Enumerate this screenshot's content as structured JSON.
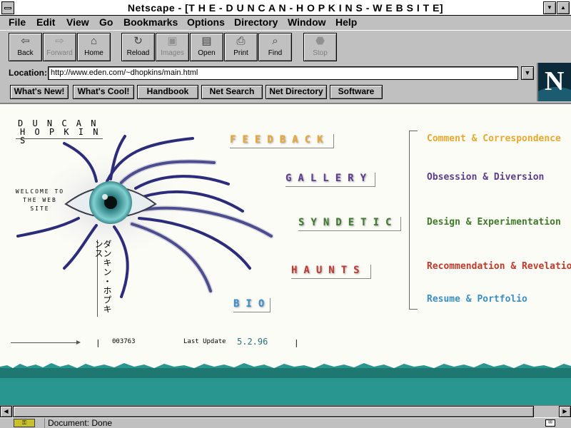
{
  "window": {
    "title": "Netscape - [T H E - D U N C A N - H O P K I N S - W E B S I T E]"
  },
  "menu": [
    "File",
    "Edit",
    "View",
    "Go",
    "Bookmarks",
    "Options",
    "Directory",
    "Window",
    "Help"
  ],
  "toolbar": [
    {
      "label": "Back",
      "icon": "back-arrow-icon",
      "glyph": "⇦",
      "enabled": true
    },
    {
      "label": "Forward",
      "icon": "forward-arrow-icon",
      "glyph": "⇨",
      "enabled": false
    },
    {
      "label": "Home",
      "icon": "home-icon",
      "glyph": "⌂",
      "enabled": true
    },
    {
      "label": "Reload",
      "icon": "reload-icon",
      "glyph": "↻",
      "enabled": true
    },
    {
      "label": "Images",
      "icon": "images-icon",
      "glyph": "▣",
      "enabled": false
    },
    {
      "label": "Open",
      "icon": "open-icon",
      "glyph": "▤",
      "enabled": true
    },
    {
      "label": "Print",
      "icon": "print-icon",
      "glyph": "⎙",
      "enabled": true
    },
    {
      "label": "Find",
      "icon": "find-binoculars-icon",
      "glyph": "⌕",
      "enabled": true
    },
    {
      "label": "Stop",
      "icon": "stop-icon",
      "glyph": "⬣",
      "enabled": false
    }
  ],
  "location": {
    "label": "Location:",
    "url": "http://www.eden.com/~dhopkins/main.html"
  },
  "directory_buttons": [
    "What's New!",
    "What's Cool!",
    "Handbook",
    "Net Search",
    "Net Directory",
    "Software"
  ],
  "logo": {
    "letter": "N"
  },
  "page": {
    "name_line1": "D U N C A N",
    "name_line2": "H O P K I N S",
    "welcome": "WELCOME TO THE WEB SITE",
    "katakana": "ダンキン・ホプキンス",
    "nav": [
      {
        "label": "FEEDBACK",
        "color": "#e8a830"
      },
      {
        "label": "GALLERY",
        "color": "#5a3d8c"
      },
      {
        "label": "SYNDETIC",
        "color": "#3f7a2a"
      },
      {
        "label": "HAUNTS",
        "color": "#c0392b"
      },
      {
        "label": "BIO",
        "color": "#3a8ec8"
      }
    ],
    "descriptions": [
      {
        "text": "Comment & Correspondence",
        "color": "#e8a830"
      },
      {
        "text": "Obsession & Diversion",
        "color": "#5a3d8c"
      },
      {
        "text": "Design & Experimentation",
        "color": "#3f7a2a"
      },
      {
        "text": "Recommendation & Revelation",
        "color": "#c0392b"
      },
      {
        "text": "Resume & Portfolio",
        "color": "#3a8ec8"
      }
    ],
    "counter": "003763",
    "last_update_label": "Last Update",
    "last_update_value": "5.2.96",
    "separator": "|"
  },
  "status": {
    "text": "Document: Done"
  }
}
